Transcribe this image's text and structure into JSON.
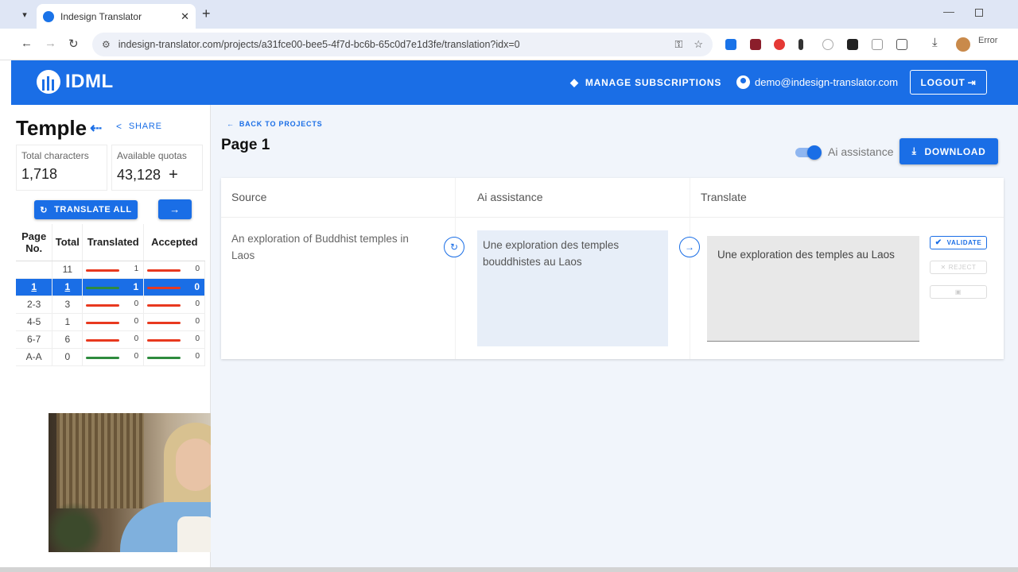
{
  "browser": {
    "tab_title": "Indesign Translator",
    "url": "indesign-translator.com/projects/a31fce00-bee5-4f7d-bc6b-65c0d7e1d3fe/translation?idx=0",
    "error_label": "Error"
  },
  "header": {
    "logo_text": "IDML",
    "manage_subscriptions": "MANAGE SUBSCRIPTIONS",
    "email": "demo@indesign-translator.com",
    "logout": "LOGOUT"
  },
  "sidebar": {
    "project_title": "Temple",
    "share": "SHARE",
    "total_characters_label": "Total characters",
    "total_characters_value": "1,718",
    "available_quotas_label": "Available quotas",
    "available_quotas_value": "43,128",
    "translate_all": "TRANSLATE ALL",
    "table_headers": [
      "Page No.",
      "Total",
      "Translated",
      "Accepted"
    ],
    "rows": [
      {
        "page": "",
        "total": "11",
        "translated": "1",
        "accepted": "0",
        "t_color": "#e8391f",
        "a_color": "#e8391f"
      },
      {
        "page": "1",
        "total": "1",
        "translated": "1",
        "accepted": "0",
        "t_color": "#2e8b3e",
        "a_color": "#e8391f"
      },
      {
        "page": "2-3",
        "total": "3",
        "translated": "0",
        "accepted": "0",
        "t_color": "#e8391f",
        "a_color": "#e8391f"
      },
      {
        "page": "4-5",
        "total": "1",
        "translated": "0",
        "accepted": "0",
        "t_color": "#e8391f",
        "a_color": "#e8391f"
      },
      {
        "page": "6-7",
        "total": "6",
        "translated": "0",
        "accepted": "0",
        "t_color": "#e8391f",
        "a_color": "#e8391f"
      },
      {
        "page": "A-A",
        "total": "0",
        "translated": "0",
        "accepted": "0",
        "t_color": "#2e8b3e",
        "a_color": "#2e8b3e"
      }
    ]
  },
  "main": {
    "back_to_projects": "BACK TO PROJECTS",
    "page_title": "Page 1",
    "ai_assistance_toggle": "Ai assistance",
    "download": "DOWNLOAD",
    "columns": [
      "Source",
      "Ai assistance",
      "Translate"
    ],
    "source_text": "An exploration of Buddhist temples in Laos",
    "ai_text": "Une exploration des temples bouddhistes au Laos",
    "translate_text": "Une exploration des temples au Laos",
    "validate": "VALIDATE",
    "reject": "REJECT"
  },
  "colors": {
    "brand": "#1a6ee6",
    "red_bar": "#e8391f",
    "green_bar": "#2e8b3e"
  }
}
